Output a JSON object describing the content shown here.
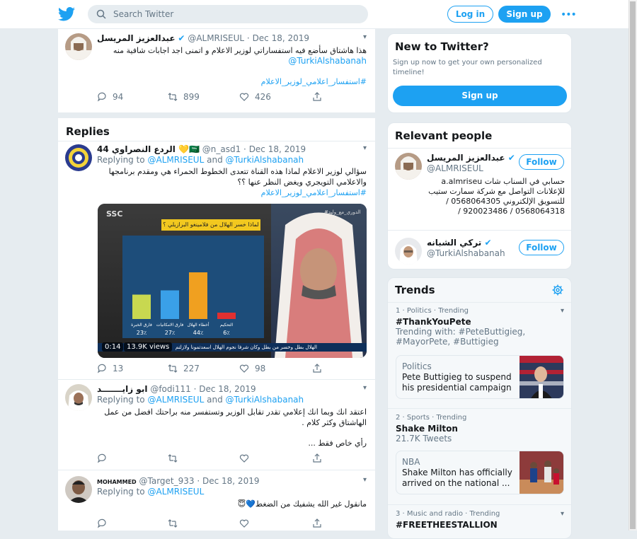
{
  "header": {
    "search_placeholder": "Search Twitter",
    "login_label": "Log in",
    "signup_label": "Sign up",
    "more_label": "•••"
  },
  "main_tweet": {
    "name": "عبدالعزيز المريسل",
    "handle": "@ALMRISEUL",
    "date": "Dec 18, 2019",
    "text": "هذا هاشتاق سأضع فيه استفساراتي لوزير الاعلام و اتمنى اجد اجابات شافية منه",
    "mention": "@TurkiAlshabanah",
    "hashtag": "#استفسار_اعلامي_لوزير_الاعلام",
    "replies": "94",
    "retweets": "899",
    "likes": "426"
  },
  "replies_heading": "Replies",
  "reply1": {
    "name": "الردع النصراوي 44 💛🇸🇦",
    "handle": "@n_asd1",
    "date": "Dec 18, 2019",
    "replying_prefix": "Replying to",
    "replying_a": "@ALMRISEUL",
    "replying_and": "and",
    "replying_b": "@TurkiAlshabanah",
    "text": "سؤالي لوزير الاعلام لماذا هذه القناة تتعدى الخطوط الحمراء هي ومقدم برنامجها والاعلامي التويجري ويغض النظر عنها ؟؟",
    "hashtag": "#استفسار_اعلامي_لوزير_الاعلام",
    "video_time": "0:14",
    "video_views": "13.9K views",
    "video_question": "لماذا خسر الهلال من فلامينغو البرازيلي ؟",
    "video_ticker": "الهلال بطل وخسر من بطل وكان شرفا نجوم الهلال اسعدتمونا ولازلتم",
    "video_tag": "#الدوري_مع_وليد",
    "video_channel": "SSC",
    "video_chart": {
      "type": "bar",
      "categories": [
        "فارق الخبرة",
        "فارق الامكانيات",
        "أخطاء الهلال",
        "التحكيم"
      ],
      "values": [
        23,
        27,
        44,
        6
      ],
      "value_labels": [
        "23٪",
        "27٪",
        "44٪",
        "6٪"
      ],
      "colors": [
        "#c8d850",
        "#3aa0e8",
        "#f0a020",
        "#e03030"
      ]
    },
    "replies": "13",
    "retweets": "227",
    "likes": "98"
  },
  "reply2": {
    "name": "ابو زايـــــــد",
    "handle": "@fodi111",
    "date": "Dec 18, 2019",
    "replying_prefix": "Replying to",
    "replying_a": "@ALMRISEUL",
    "replying_and": "and",
    "replying_b": "@TurkiAlshabanah",
    "text1": "اعتقد انك وبما انك إعلامي تقدر تقابل الوزير وتستفسر منه براحتك افضل من عمل الهاشتاق وكثر كلام .",
    "text2": "رأي خاص فقط ..."
  },
  "reply3": {
    "name": "MOHAMMED",
    "handle": "@Target_933",
    "date": "Dec 18, 2019",
    "replying_prefix": "Replying to",
    "replying_a": "@ALMRISEUL",
    "text": "مانقول غير الله يشفيك من الضغط💙😇"
  },
  "new_to_twitter": {
    "title": "New to Twitter?",
    "desc": "Sign up now to get your own personalized timeline!",
    "button": "Sign up"
  },
  "relevant": {
    "title": "Relevant people",
    "p1_name": "عبدالعزيز المريسل",
    "p1_handle": "@ALMRISEUL",
    "p1_bio": "حسابي في السناب شات a.almriseu للإعلانات التواصل مع شركة سمارت ستيب للتسويق الإلكتروني 0568064305 / 0568064318 / 920023486 /",
    "p2_name": "تركي الشبانه",
    "p2_handle": "@TurkiAlshabanah",
    "follow": "Follow"
  },
  "trends": {
    "title": "Trends",
    "t1_meta": "1 · Politics · Trending",
    "t1_name": "#ThankYouPete",
    "t1_sub": "Trending with: #PeteButtigieg, #MayorPete, #Buttigieg",
    "t1_card_src": "Politics",
    "t1_card_title": "Pete Buttigieg to suspend his presidential campaign",
    "t2_meta": "2 · Sports · Trending",
    "t2_name": "Shake Milton",
    "t2_sub": "21.7K Tweets",
    "t2_card_src": "NBA",
    "t2_card_title": "Shake Milton has officially arrived on the national ...",
    "t3_meta": "3 · Music and radio · Trending",
    "t3_name": "#FREETHEESTALLION"
  },
  "colors": {
    "accent": "#1da1f2",
    "background": "#e6ecf0",
    "muted": "#657786"
  }
}
